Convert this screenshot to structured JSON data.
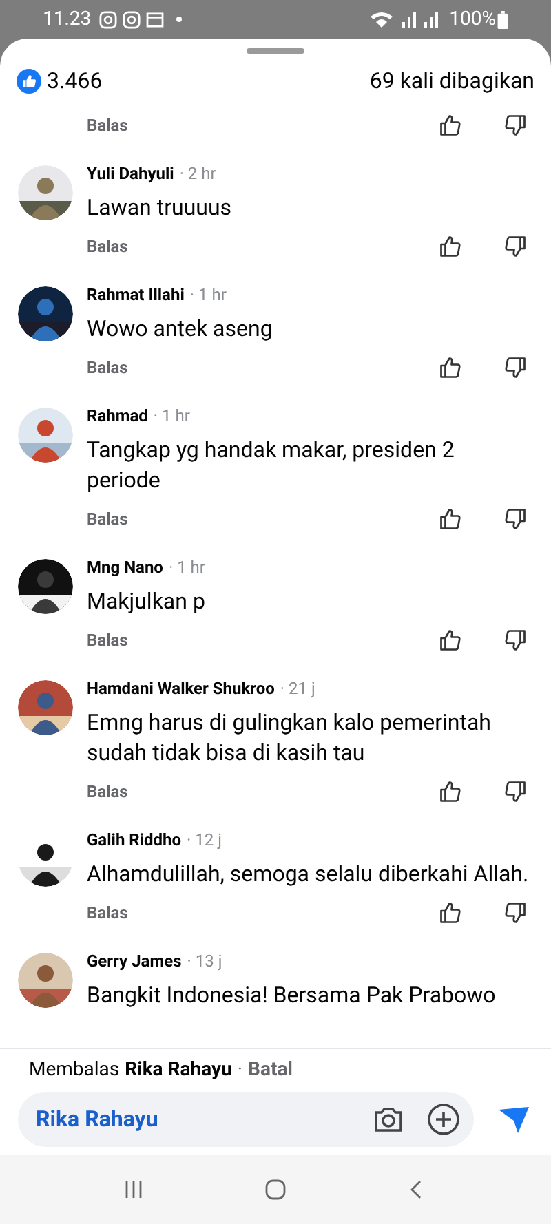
{
  "status_bar": {
    "time": "11.23",
    "battery": "100%"
  },
  "header": {
    "likes": "3.466",
    "shares": "69 kali dibagikan"
  },
  "top_reply": {
    "reply": "Balas"
  },
  "comments": [
    {
      "name": "Yuli Dahyuli",
      "time": "· 2 hr",
      "text": "Lawan truuuus",
      "reply": "Balas"
    },
    {
      "name": "Rahmat Illahi",
      "time": "· 1 hr",
      "text": "Wowo antek aseng",
      "reply": "Balas"
    },
    {
      "name": "Rahmad",
      "time": "· 1 hr",
      "text": "Tangkap yg handak makar, presiden 2 periode",
      "reply": "Balas"
    },
    {
      "name": "Mng Nano",
      "time": "· 1 hr",
      "text": "Makjulkan p",
      "reply": "Balas"
    },
    {
      "name": "Hamdani Walker Shukroo",
      "time": "· 21 j",
      "text": "Emng harus di gulingkan kalo pemerintah sudah tidak bisa di kasih tau",
      "reply": "Balas"
    },
    {
      "name": "Galih Riddho",
      "time": "· 12 j",
      "text": "Alhamdulillah, semoga selalu diberkahi Allah.",
      "reply": "Balas"
    },
    {
      "name": "Gerry James",
      "time": "· 13 j",
      "text": "Bangkit Indonesia! Bersama Pak Prabowo"
    }
  ],
  "composer": {
    "replying_label": "Membalas",
    "replying_to": "Rika Rahayu",
    "separator": "·",
    "cancel": "Batal",
    "value": "Rika Rahayu"
  }
}
